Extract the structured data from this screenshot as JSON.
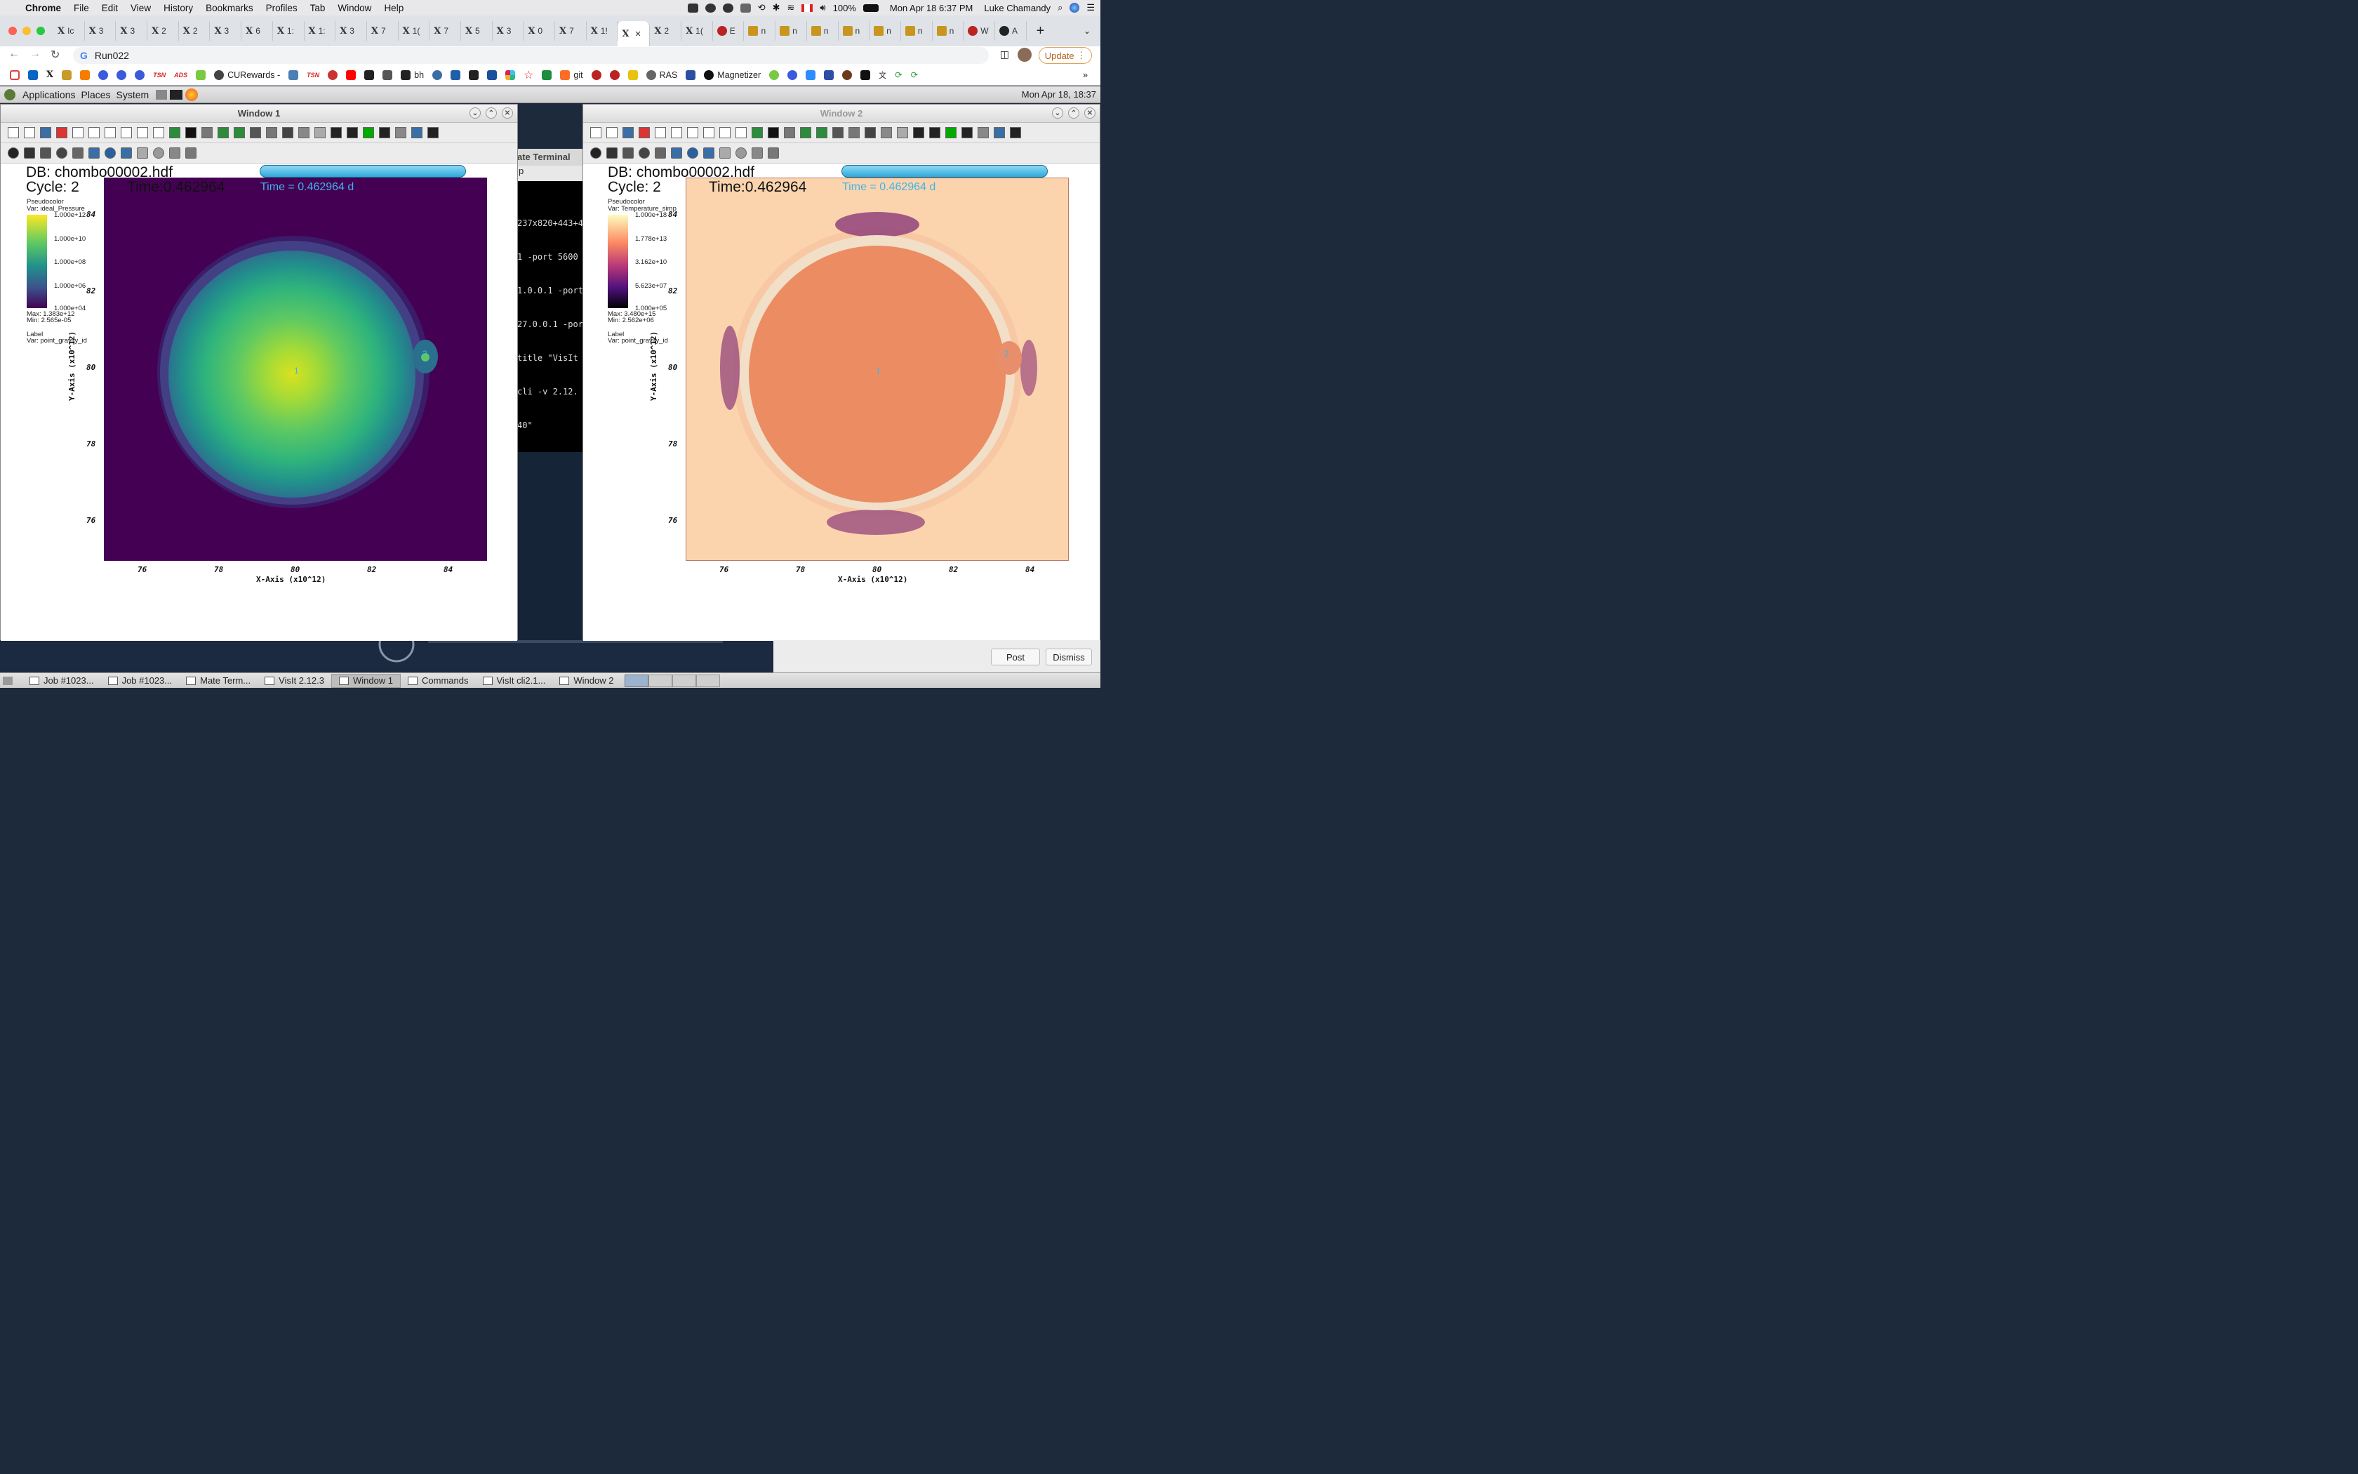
{
  "menubar": {
    "app": "Chrome",
    "items": [
      "File",
      "Edit",
      "View",
      "History",
      "Bookmarks",
      "Profiles",
      "Tab",
      "Window",
      "Help"
    ],
    "battery": "100%",
    "datetime": "Mon Apr 18  6:37 PM",
    "user": "Luke Chamandy"
  },
  "tabs": [
    {
      "label": "Ic",
      "icon": "x-icon"
    },
    {
      "label": "3",
      "icon": "x-icon"
    },
    {
      "label": "3",
      "icon": "x-icon"
    },
    {
      "label": "2",
      "icon": "x-icon"
    },
    {
      "label": "2",
      "icon": "x-icon"
    },
    {
      "label": "3",
      "icon": "x-icon"
    },
    {
      "label": "6",
      "icon": "x-icon"
    },
    {
      "label": "1:",
      "icon": "x-icon"
    },
    {
      "label": "1:",
      "icon": "x-icon"
    },
    {
      "label": "3",
      "icon": "x-icon"
    },
    {
      "label": "7",
      "icon": "x-icon"
    },
    {
      "label": "1(",
      "icon": "x-icon"
    },
    {
      "label": "7",
      "icon": "x-icon"
    },
    {
      "label": "5",
      "icon": "x-icon"
    },
    {
      "label": "3",
      "icon": "x-icon"
    },
    {
      "label": "0",
      "icon": "x-icon"
    },
    {
      "label": "7",
      "icon": "x-icon"
    },
    {
      "label": "1!",
      "icon": "x-icon"
    },
    {
      "label": "",
      "icon": "x-icon",
      "active": true
    },
    {
      "label": "2",
      "icon": "x-icon"
    },
    {
      "label": "1(",
      "icon": "x-icon"
    },
    {
      "label": "E",
      "icon": "paw-icon"
    },
    {
      "label": "n",
      "icon": "sun-icon"
    },
    {
      "label": "n",
      "icon": "sun-icon"
    },
    {
      "label": "n",
      "icon": "sun-icon"
    },
    {
      "label": "n",
      "icon": "sun-icon"
    },
    {
      "label": "n",
      "icon": "sun-icon"
    },
    {
      "label": "n",
      "icon": "sun-icon"
    },
    {
      "label": "n",
      "icon": "sun-icon"
    },
    {
      "label": "W",
      "icon": "paw-icon"
    },
    {
      "label": "A",
      "icon": "info-icon"
    }
  ],
  "address": {
    "url": "Run022",
    "update_label": "Update"
  },
  "bookmarks": {
    "labeled": [
      {
        "label": "CURewards -",
        "pos": "cu"
      },
      {
        "label": "bh",
        "pos": "bh"
      },
      {
        "label": "git",
        "pos": "git"
      },
      {
        "label": "RAS",
        "pos": "ras"
      },
      {
        "label": "Magnetizer",
        "pos": "mag"
      }
    ]
  },
  "gnome": {
    "applications": "Applications",
    "places": "Places",
    "system": "System",
    "clock": "Mon Apr 18, 18:37"
  },
  "window1": {
    "title": "Window 1",
    "db": "DB: chombo00002.hdf",
    "cycle": "Cycle: 2",
    "time_black": "Time:0.462964",
    "time_blue": "Time = 0.462964 d",
    "legend_title": "Pseudocolor",
    "legend_var": "Var: ideal_Pressure",
    "colorbar_labels": [
      "1.000e+12",
      "1.000e+10",
      "1.000e+08",
      "1.000e+06",
      "1.000e+04"
    ],
    "max": "Max:  1.383e+12",
    "min": "Min:  2.565e-05",
    "label_title": "Label",
    "label_var": "Var: point_gravity_id",
    "marker1": "1",
    "marker2": "2"
  },
  "window2": {
    "title": "Window 2",
    "db": "DB: chombo00002.hdf",
    "cycle": "Cycle: 2",
    "time_black": "Time:0.462964",
    "time_blue": "Time = 0.462964 d",
    "legend_title": "Pseudocolor",
    "legend_var": "Var: Temperature_simp",
    "colorbar_labels": [
      "1.000e+18",
      "1.778e+13",
      "3.162e+10",
      "5.623e+07",
      "1.000e+05"
    ],
    "max": "Max:  3.480e+15",
    "min": "Min:  2.562e+06",
    "label_title": "Label",
    "label_var": "Var: point_gravity_id",
    "marker1": "1",
    "marker2": "2"
  },
  "axes": {
    "x_label": "X-Axis (x10^12)",
    "y_label": "Y-Axis (x10^12)",
    "x_ticks": [
      "76",
      "78",
      "80",
      "82",
      "84"
    ],
    "y_ticks": [
      "84",
      "82",
      "80",
      "78",
      "76"
    ]
  },
  "terminal": {
    "title": "ate Terminal",
    "menu": "p",
    "lines": [
      "237x820+443+4",
      "1 -port 5600",
      "1.0.0.1 -port",
      "27.0.0.1 -por",
      "title \"VisIt",
      "cli -v 2.12.",
      "40\""
    ]
  },
  "notification": {
    "post": "Post",
    "dismiss": "Dismiss"
  },
  "taskbar": {
    "items": [
      {
        "label": "Job #1023..."
      },
      {
        "label": "Job #1023..."
      },
      {
        "label": "Mate Term..."
      },
      {
        "label": "VisIt 2.12.3"
      },
      {
        "label": "Window 1",
        "active": true
      },
      {
        "label": "Commands"
      },
      {
        "label": "VisIt cli2.1..."
      },
      {
        "label": "Window 2"
      }
    ]
  },
  "colors": {
    "viridis_bg": "#440154",
    "magma_bg": "#fbd7b0",
    "sphere_orange": "#ec8c62",
    "accent_blue": "#3fb4e8"
  }
}
